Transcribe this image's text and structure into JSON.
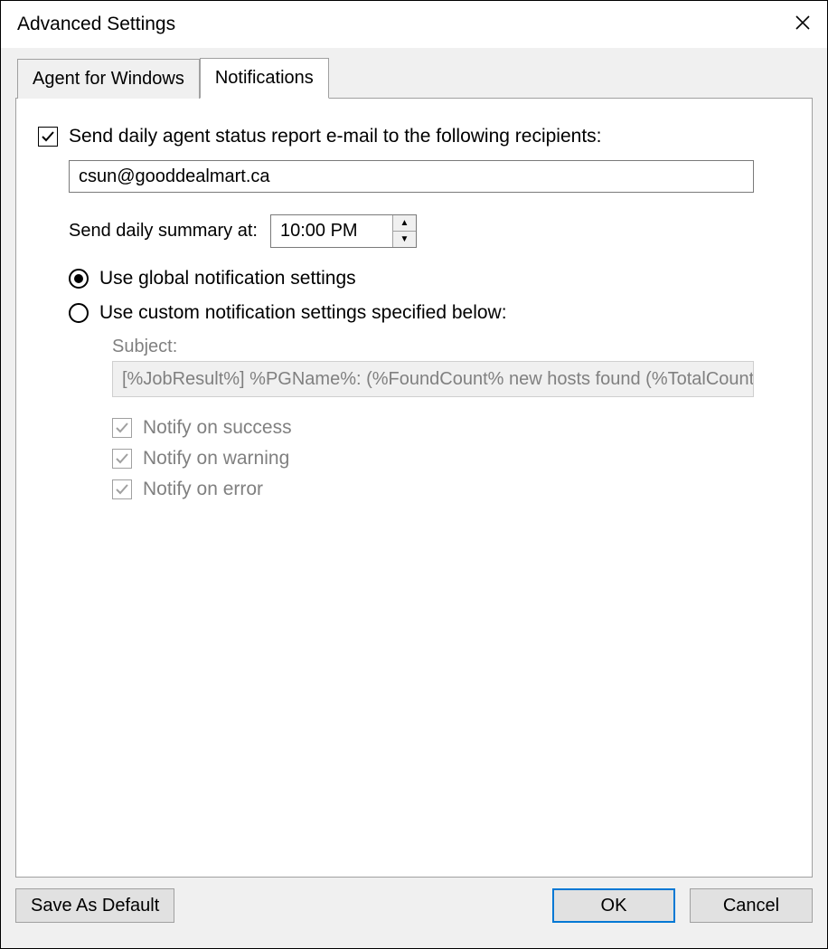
{
  "window": {
    "title": "Advanced Settings"
  },
  "tabs": [
    {
      "label": "Agent for Windows",
      "active": false
    },
    {
      "label": "Notifications",
      "active": true
    }
  ],
  "notifications": {
    "send_report_label": "Send daily agent status report e-mail to the following recipients:",
    "send_report_checked": true,
    "recipients_value": "csun@gooddealmart.ca",
    "send_summary_label": "Send daily summary at:",
    "send_summary_time": "10:00 PM",
    "radio_global_label": "Use global notification settings",
    "radio_custom_label": "Use custom notification settings specified below:",
    "radio_selected": "global",
    "subject_label": "Subject:",
    "subject_value": "[%JobResult%] %PGName%: (%FoundCount% new hosts found (%TotalCount% total)",
    "notify_success_label": "Notify on success",
    "notify_success_checked": true,
    "notify_warning_label": "Notify on warning",
    "notify_warning_checked": true,
    "notify_error_label": "Notify on error",
    "notify_error_checked": true
  },
  "footer": {
    "save_default_label": "Save As Default",
    "ok_label": "OK",
    "cancel_label": "Cancel"
  }
}
